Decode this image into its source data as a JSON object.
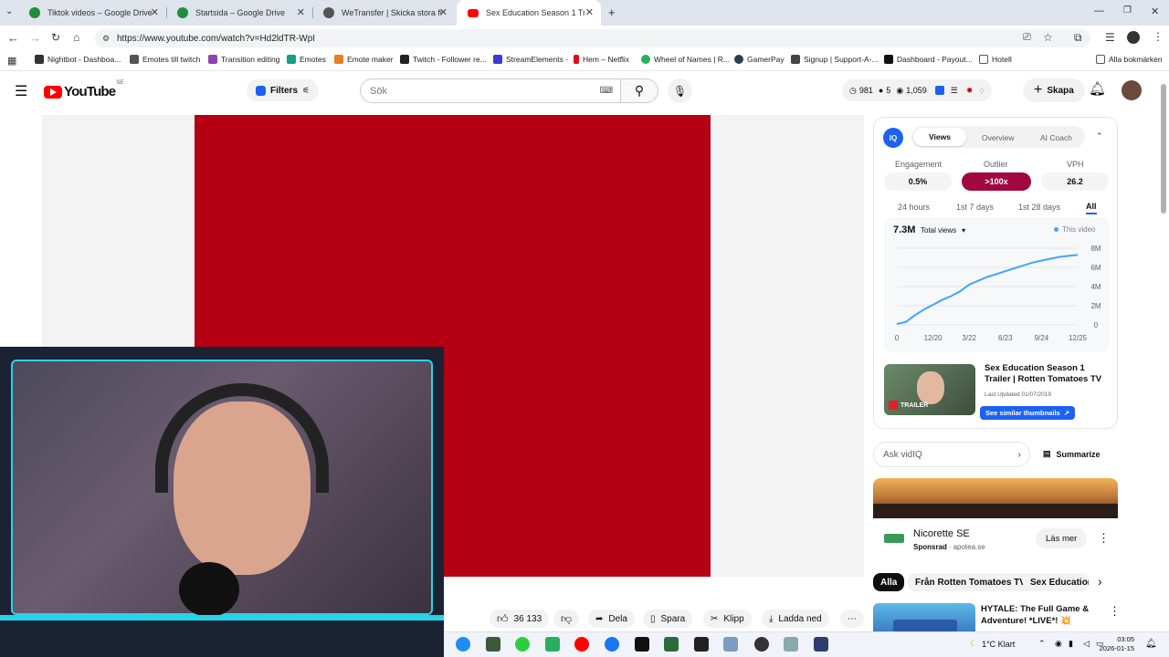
{
  "browser": {
    "tabs": [
      {
        "title": "Tiktok videos – Google Drive",
        "color": "#1e8e3e"
      },
      {
        "title": "Startsida – Google Drive",
        "color": "#1e8e3e"
      },
      {
        "title": "WeTransfer | Skicka stora filer s",
        "color": "#555555"
      },
      {
        "title": "Sex Education Season 1 Trailer |",
        "color": "#ff0000"
      }
    ],
    "url": "https://www.youtube.com/watch?v=Hd2ldTR-WpI",
    "bookmarks": [
      "Nightbot - Dashboa...",
      "Emotes till twitch",
      "Transition editing",
      "Emotes",
      "Emote maker",
      "Twitch - Follower re...",
      "StreamElements -",
      "Hem – Netflix",
      "Wheel of Names | R...",
      "GamerPay",
      "Signup | Support-A-...",
      "Dashboard - Payout...",
      "Hotell"
    ],
    "all_bookmarks": "Alla bokmärken"
  },
  "youtube": {
    "logo": "YouTube",
    "region": "SE",
    "filters": "Filters",
    "search_placeholder": "Sök",
    "stats": {
      "a": "981",
      "b": "5",
      "c": "1,059"
    },
    "create": "Skapa"
  },
  "actions": {
    "likes": "36 133",
    "share": "Dela",
    "save": "Spara",
    "clip": "Klipp",
    "download": "Ladda ned"
  },
  "vidiq": {
    "logo": "IQ",
    "tabs": [
      "Views",
      "Overview",
      "AI Coach"
    ],
    "metrics": [
      {
        "label": "Engagement",
        "value": "0.5%"
      },
      {
        "label": "Outlier",
        "value": ">100x"
      },
      {
        "label": "VPH",
        "value": "26.2"
      }
    ],
    "ranges": [
      "24 hours",
      "1st 7 days",
      "1st 28 days",
      "All"
    ],
    "total": "7.3M",
    "select": "Total views",
    "legend": "This video",
    "video_title": "Sex Education Season 1 Trailer | Rotten Tomatoes TV",
    "updated": "Last Updated 01/07/2019",
    "similar": "See similar thumbnails",
    "thumb_tag": "TRAILER",
    "ask": "Ask vidIQ",
    "summarize": "Summarize"
  },
  "chart_data": {
    "type": "line",
    "x_ticks": [
      "0",
      "12/20",
      "3/22",
      "6/23",
      "9/24",
      "12/25"
    ],
    "y_ticks": [
      "8M",
      "6M",
      "4M",
      "2M",
      "0"
    ],
    "ylim": [
      0,
      8
    ],
    "x": [
      0,
      0.05,
      0.1,
      0.15,
      0.2,
      0.25,
      0.3,
      0.35,
      0.4,
      0.45,
      0.5,
      0.55,
      0.6,
      0.65,
      0.7,
      0.75,
      0.8,
      0.85,
      0.9,
      0.95,
      1
    ],
    "series": [
      {
        "values": [
          0.1,
          0.3,
          1.0,
          1.6,
          2.1,
          2.6,
          3.0,
          3.5,
          4.2,
          4.6,
          5.0,
          5.3,
          5.6,
          5.9,
          6.2,
          6.5,
          6.7,
          6.9,
          7.1,
          7.2,
          7.3
        ],
        "color": "#3ea6ff"
      }
    ]
  },
  "ad": {
    "brand": "Nicorette SE",
    "sponsored": "Sponsrad",
    "domain": "apotea.se",
    "cta": "Läs mer"
  },
  "chips": [
    "Alla",
    "Från Rotten Tomatoes TV",
    "Sex Education"
  ],
  "recommended": {
    "title": "HYTALE: The Full Game & Adventure! *LIVE*! 💥"
  },
  "taskbar": {
    "weather": "1°C  Klart",
    "time": "03:05",
    "date": "2026-01-15"
  },
  "overlay": {
    "symbol": "$"
  }
}
